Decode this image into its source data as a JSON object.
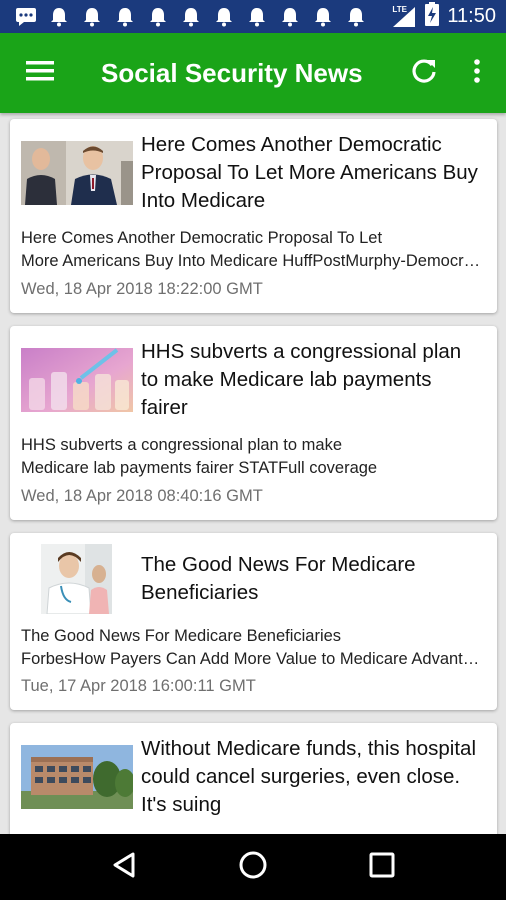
{
  "status_bar": {
    "time": "11:50",
    "network": "LTE",
    "notification_icons": [
      "message-icon",
      "bell-icon",
      "bell-icon",
      "bell-icon",
      "bell-icon",
      "bell-icon",
      "bell-icon",
      "bell-icon",
      "bell-icon",
      "bell-icon",
      "bell-icon"
    ]
  },
  "app_bar": {
    "title": "Social Security News",
    "color": "#1aa418"
  },
  "articles": [
    {
      "headline": "Here Comes Another Democratic Proposal To Let More Americans Buy Into Medicare",
      "description_line1": "Here Comes Another Democratic Proposal To Let",
      "description_line2": "More Americans Buy Into Medicare  HuffPostMurphy-Democratic Senator",
      "date": "Wed, 18 Apr 2018 18:22:00 GMT",
      "thumbnail": "senators-photo"
    },
    {
      "headline": "HHS subverts a congressional plan to make Medicare lab payments fairer",
      "description_line1": "HHS subverts a congressional plan to make",
      "description_line2": "Medicare lab payments fairer  STATFull coverage",
      "date": "Wed, 18 Apr 2018 08:40:16 GMT",
      "thumbnail": "lab-test-tubes-photo"
    },
    {
      "headline": "The Good News For Medicare Beneficiaries",
      "description_line1": "The Good News For Medicare Beneficiaries",
      "description_line2": "ForbesHow Payers Can Add More Value to Medicare Advantage",
      "date": "Tue, 17 Apr 2018 16:00:11 GMT",
      "thumbnail": "doctor-photo"
    },
    {
      "headline": "Without Medicare funds, this hospital could cancel surgeries, even close. It's suing",
      "thumbnail": "hospital-building-photo"
    }
  ],
  "nav_bar": {
    "buttons": [
      "back-icon",
      "home-icon",
      "recents-icon"
    ]
  }
}
